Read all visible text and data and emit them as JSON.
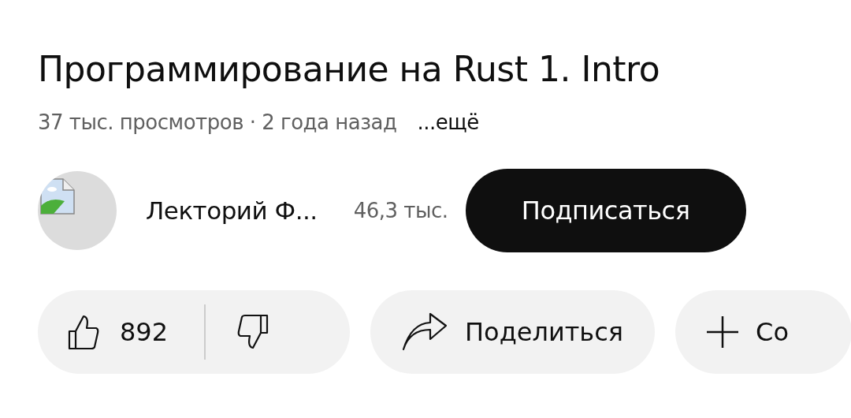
{
  "video": {
    "title": "Программирование на Rust 1. Intro",
    "meta": "37 тыс. просмотров · 2 года назад",
    "more": "...ещё"
  },
  "channel": {
    "name": "Лекторий Ф...",
    "subscribers": "46,3 тыс.",
    "subscribe_button": "Подписаться"
  },
  "actions": {
    "like_count": "892",
    "share": "Поделиться",
    "save": "Со"
  }
}
